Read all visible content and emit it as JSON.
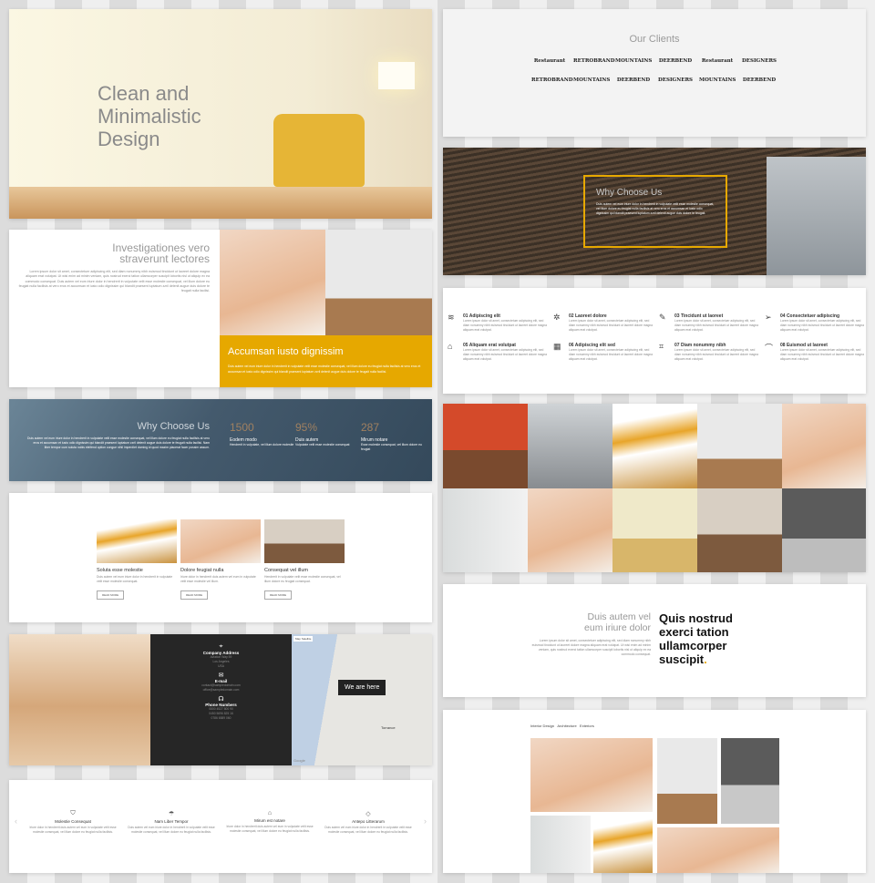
{
  "hero": {
    "title_lines": [
      "Clean and",
      "Minimalistic",
      "Design"
    ]
  },
  "intro": {
    "title_lines": [
      "Investigationes vero",
      "straverunt lectores"
    ],
    "body": "Lorem ipsum dolor sit amet, consectetuer adipiscing elit, sed diam nonummy nibh euismod tincidunt ut laoreet dolore magna aliquam erat volutpat. Ut wisi enim ad minim veniam, quis nostrud exerci tation ullamcorper suscipit lobortis nisl ut aliquip ex ea commodo consequat. Duis autem vel eum iriure dolor in hendrerit in vulputate velit esse molestie consequat, vel illum dolore eu feugiat nulla facilisis at vero eros et accumsan et iusto odio dignissim qui blandit praesent luptatum zzril delenit augue duis dolore te feugait nulla facilisi.",
    "accent_title": "Accumsan iusto dignissim",
    "accent_body": "Duis autem vel eum iriure dolor in hendrerit in vulputate velit esse molestie consequat, vel illum dolore eu feugiat nulla facilisis at vero eros et accumsan et iusto odio dignissim qui blandit praesent luptatum zzril delenit augue duis dolore te feugait nulla facilisi.",
    "accent_color": "#e6a800"
  },
  "why_blue": {
    "title": "Why Choose Us",
    "body": "Duis autem vel eum iriure dolor in hendrerit in vulputate velit esse molestie consequat, vel illum dolore eu feugiat nulla facilisis at vero eros et accumsan et iusto odio dignissim qui blandit praesent luptatum zzril delenit augue duis dolore te feugait nulla facilisi. Nam liber tempor cum soluta nobis eleifend option congue nihil imperdiet doming id quod mazim placerat facer possim assum.",
    "stats": [
      {
        "value": "1500",
        "label": "Eodem modo",
        "text": "Hendrerit in vulputate, vel illum dolore molestie"
      },
      {
        "value": "95%",
        "label": "Duis autem",
        "text": "Vulputate velit esse molestie consequat"
      },
      {
        "value": "287",
        "label": "Mirum notare",
        "text": "Esse molestie consequat, vel illum dolore eu feugiat"
      }
    ]
  },
  "services": [
    {
      "title": "Soluta esse molestie",
      "text": "Duis autem vel eum iriure dolor in hendrerit in vulputate velit esse molestie consequat.",
      "button": "READ MORE"
    },
    {
      "title": "Dolore feugiat nulla",
      "text": "Iriure dolor in hendrerit duis autem vel eum in vulputate velit esse molestie vel illum.",
      "button": "READ MORE"
    },
    {
      "title": "Consequat vel illum",
      "text": "Hendrerit in vulputate velit esse molestie consequat, vel illum dolore eu feugiat consequat.",
      "button": "READ MORE"
    }
  ],
  "contact": {
    "address_title": "Company Address",
    "address": [
      "Aviation Way 59",
      "Los Angeles",
      "USA"
    ],
    "email_title": "E-mail",
    "emails": [
      "contact@sampledomain.com",
      "office@sampledomain.com"
    ],
    "phone_title": "Phone Numbers",
    "phones": [
      "0800 4527 800 90",
      "0450 5696 825 16",
      "0786 6589 060"
    ],
    "map_tabs": [
      "Map",
      "Satellite"
    ],
    "map_label": "We are here",
    "map_places": [
      "Torrance",
      "Google"
    ]
  },
  "carousel": [
    {
      "icon": "badge-icon",
      "title": "Molestie Consequat",
      "text": "Iriure dolor in hendrerit duis autem vel eum in vulputate velit esse molestie consequat, vel illum dolore eu feugiat nulla facilisis."
    },
    {
      "icon": "umbrella-icon",
      "title": "Nam Liber Tempor",
      "text": "Duis autem vel eum iriure dolor in hendrerit in vulputate velit esse molestie consequat, vel illum dolore eu feugiat nulla facilisis."
    },
    {
      "icon": "home-icon",
      "title": "Mirum est notare",
      "text": "Iriure dolor in hendrerit duis autem vel eum in vulputate velit esse molestie consequat, vel illum dolore eu feugiat nulla facilisis."
    },
    {
      "icon": "diamond-icon",
      "title": "Antepo Litterarum",
      "text": "Duis autem vel eum iriure dolor in hendrerit in vulputate velit esse molestie consequat, vel illum dolore eu feugiat nulla facilisis."
    }
  ],
  "clients": {
    "title": "Our Clients",
    "logos": [
      "Restaurant",
      "RETROBRAND",
      "MOUNTAINS",
      "DEERBEND",
      "Restaurant",
      "DESIGNERS",
      "RETROBRAND",
      "MOUNTAINS",
      "DEERBEND",
      "DESIGNERS",
      "MOUNTAINS",
      "DEERBEND"
    ]
  },
  "why_dark": {
    "title": "Why Choose Us",
    "body": "Duis autem vel eum iriure dolor in hendrerit in vulputate velit esse molestie consequat, vel illum dolore eu feugiat nulla facilisis at vero eros et accumsan et iusto odio dignissim qui blandit praesent luptatum zzril delenit augue duis dolore te feugait.",
    "border_color": "#e6a800"
  },
  "features": [
    {
      "icon": "layers-icon",
      "title": "01 Adipiscing elit"
    },
    {
      "icon": "pin-icon",
      "title": "02 Laoreet dolore"
    },
    {
      "icon": "pencil-icon",
      "title": "03 Tincidunt ut laoreet"
    },
    {
      "icon": "send-icon",
      "title": "04 Consectetuer adipiscing"
    },
    {
      "icon": "home-icon",
      "title": "05 Aliquam erat volutpat"
    },
    {
      "icon": "grid-icon",
      "title": "06 Adipiscing elit sed"
    },
    {
      "icon": "crop-icon",
      "title": "07 Diam nonummy nibh"
    },
    {
      "icon": "bezier-icon",
      "title": "08 Euismod ut laoreet"
    }
  ],
  "features_text": "Lorem ipsum dolor sit amet, consectetuer adipiscing elit, sed diam nonummy nibh euismod tincidunt ut laoreet dolore magna aliquam erat volutpat.",
  "quote": {
    "title_lines": [
      "Duis autem vel",
      "eum iriure dolor"
    ],
    "body": "Lorem ipsum dolor sit amet, consectetuer adipiscing elit, sed diam nonummy nibh euismod tincidunt ut laoreet dolore magna aliquam erat volutpat. Ut wisi enim ad minim veniam, quis nostrud exerci tation ullamcorper suscipit lobortis nisl ut aliquip ex ea commodo consequat.",
    "bold": "Quis nostrud exerci tation ullamcorper suscipit",
    "dot": "."
  },
  "portfolio": {
    "tabs": [
      "Interior Design",
      "Architecture",
      "Exteriors"
    ]
  }
}
